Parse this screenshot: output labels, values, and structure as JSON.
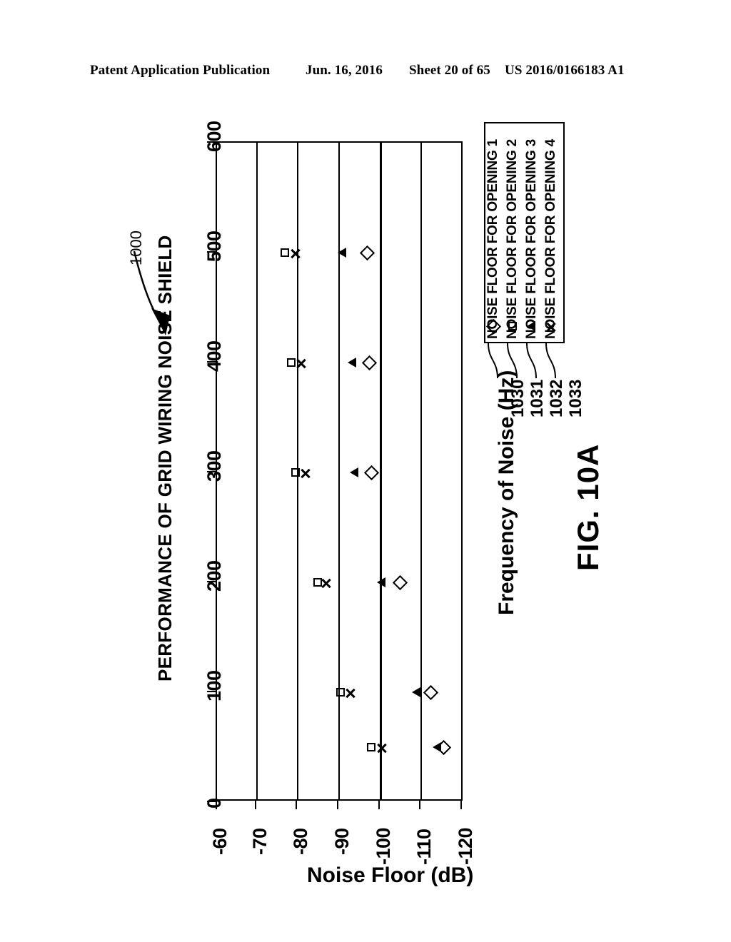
{
  "header": {
    "publication": "Patent Application Publication",
    "date": "Jun. 16, 2016",
    "sheet": "Sheet 20 of 65",
    "number": "US 2016/0166183 A1"
  },
  "figure": {
    "fig_label": "FIG. 10A",
    "callout_ref": "1000",
    "reference_numbers": [
      "1030",
      "1031",
      "1032",
      "1033"
    ]
  },
  "chart_data": {
    "type": "scatter",
    "title": "PERFORMANCE OF GRID WIRING NOISE SHIELD",
    "xlabel": "Frequency of Noise (Hz)",
    "ylabel": "Noise Floor (dB)",
    "orientation": "rotated-90",
    "grid": true,
    "legend_position": "right",
    "x": [
      50,
      100,
      200,
      300,
      400,
      500
    ],
    "xlim": [
      0,
      600
    ],
    "xticks": [
      0,
      100,
      200,
      300,
      400,
      500,
      600
    ],
    "xtick_labels": [
      "0",
      "100",
      "200",
      "300",
      "400",
      "500",
      "600"
    ],
    "ylim": [
      -60,
      -120
    ],
    "yticks": [
      -60,
      -70,
      -80,
      -90,
      -100,
      -110,
      -120
    ],
    "ytick_labels": [
      "-60",
      "-70",
      "-80",
      "-90",
      "-100",
      "-110",
      "-120"
    ],
    "series": [
      {
        "name": "NOISE FLOOR FOR OPENING 1",
        "ref": "1030",
        "marker": "diamond",
        "values": [
          -115.0,
          -112.0,
          -104.5,
          -97.5,
          -97.0,
          -96.5
        ]
      },
      {
        "name": "NOISE FLOOR FOR OPENING 2",
        "ref": "1031",
        "marker": "square",
        "values": [
          -97.5,
          -90.0,
          -84.5,
          -79.0,
          -78.0,
          -76.5
        ]
      },
      {
        "name": "NOISE FLOOR FOR OPENING 3",
        "ref": "1032",
        "marker": "triangle",
        "values": [
          -113.5,
          -108.5,
          -100.0,
          -93.5,
          -93.0,
          -90.5
        ]
      },
      {
        "name": "NOISE FLOOR FOR OPENING 4",
        "ref": "1033",
        "marker": "x",
        "values": [
          -100.0,
          -92.5,
          -86.5,
          -81.5,
          -80.5,
          -79.0
        ]
      }
    ]
  }
}
